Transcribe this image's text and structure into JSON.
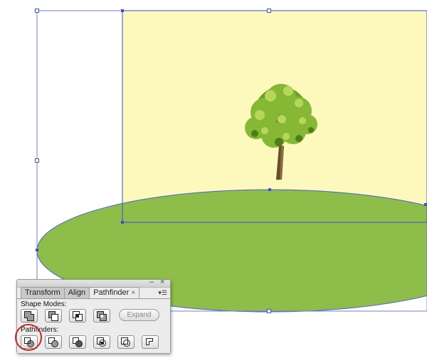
{
  "panel": {
    "tabs": [
      {
        "label": "Transform"
      },
      {
        "label": "Align"
      },
      {
        "label": "Pathfinder",
        "active": true,
        "close_glyph": "×"
      }
    ],
    "minimize_glyph": "–",
    "close_glyph": "×",
    "menu_glyph": "▾☰",
    "shape_modes_label": "Shape Modes:",
    "shape_mode_buttons": [
      "unite-icon",
      "minus-front-icon",
      "intersect-icon",
      "exclude-icon"
    ],
    "expand_label": "Expand",
    "pathfinders_label": "Pathfinders:",
    "pathfinder_buttons": [
      "divide-icon",
      "trim-icon",
      "merge-icon",
      "crop-icon",
      "outline-icon",
      "minus-back-icon"
    ],
    "highlighted_button": "divide-icon"
  },
  "colors": {
    "sky": "#fdf8bb",
    "ground": "#8fbd4a",
    "selection": "#3b4fcf",
    "highlight": "#c62828"
  }
}
